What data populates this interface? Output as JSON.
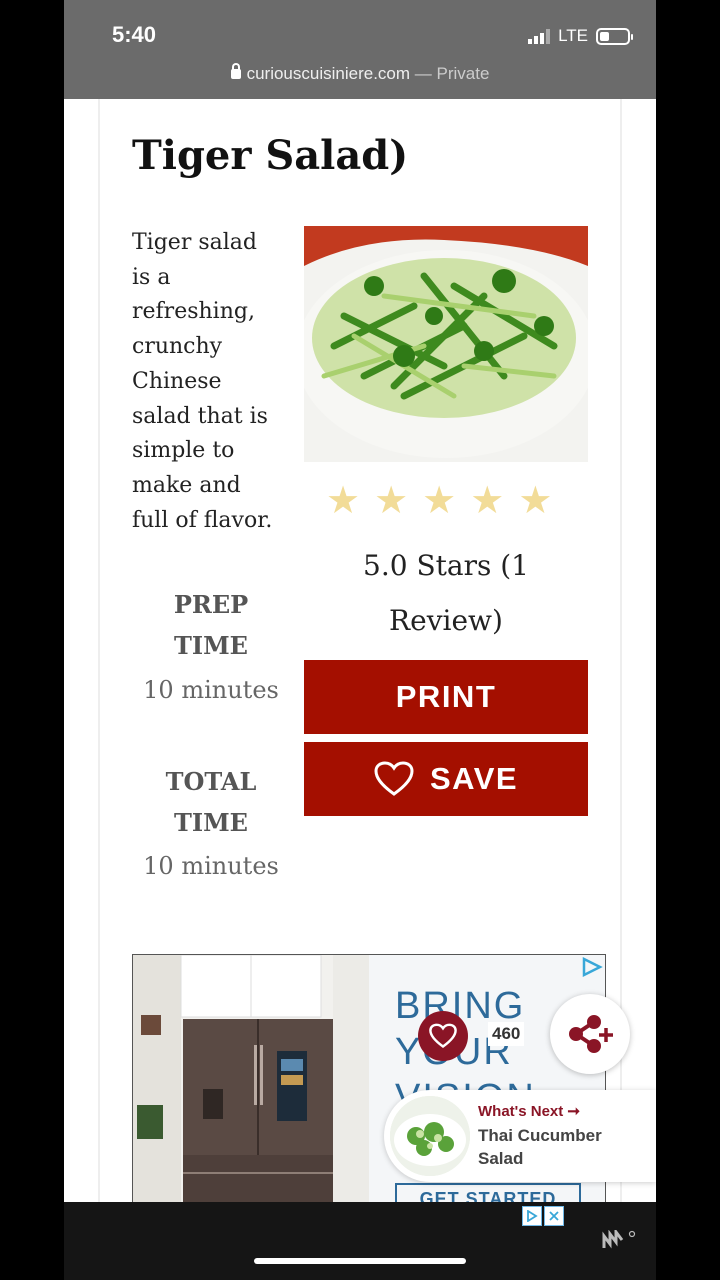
{
  "status_bar": {
    "time": "5:40",
    "network": "LTE",
    "battery_level": 0.35
  },
  "browser": {
    "domain": "curiouscuisiniere.com",
    "mode": "— Private"
  },
  "recipe": {
    "title": "Tiger Salad)",
    "description": "Tiger salad is a refreshing, crunchy Chinese salad that is simple to make and full of flavor.",
    "rating_stars": 5,
    "rating_text": "5.0 Stars (1 Review)",
    "prep_time_label_1": "PREP",
    "prep_time_label_2": "TIME",
    "prep_time_value": "10 minutes",
    "total_time_label_1": "TOTAL",
    "total_time_label_2": "TIME",
    "total_time_value": "10 minutes",
    "print_label": "PRINT",
    "save_label": "SAVE"
  },
  "ad": {
    "headline_1": "BRING",
    "headline_2": "YOUR",
    "headline_3": "VISION",
    "cta": "GET STARTED"
  },
  "floating": {
    "save_count": "460"
  },
  "whats_next": {
    "label": "What's Next ➞",
    "title": "Thai Cucumber Salad"
  },
  "colors": {
    "primary_red": "#a40f00",
    "maroon": "#8a1526",
    "star": "#f2dc98",
    "ad_blue": "#2d6a9a"
  }
}
